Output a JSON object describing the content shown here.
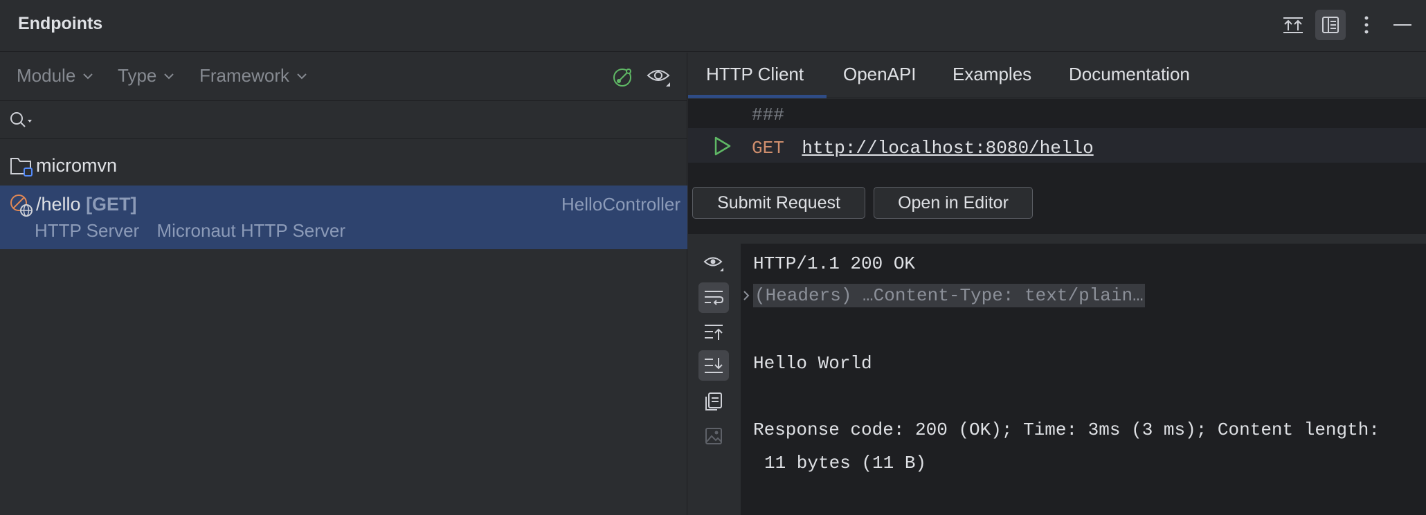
{
  "panel": {
    "title": "Endpoints"
  },
  "filters": {
    "module": "Module",
    "type": "Type",
    "framework": "Framework"
  },
  "tree": {
    "module_name": "micromvn",
    "endpoint": {
      "path": "/hello",
      "method": "[GET]",
      "controller": "HelloController",
      "server_type": "HTTP Server",
      "server_name": "Micronaut HTTP Server"
    }
  },
  "tabs": [
    "HTTP Client",
    "OpenAPI",
    "Examples",
    "Documentation"
  ],
  "editor": {
    "separator": "###",
    "method": "GET",
    "url": "http://localhost:8080/hello"
  },
  "buttons": {
    "submit": "Submit Request",
    "open_editor": "Open in Editor"
  },
  "response": {
    "status_line": "HTTP/1.1 200 OK",
    "headers_folded": "(Headers) …Content-Type: text/plain…",
    "body": "Hello World",
    "summary_line1": "Response code: 200 (OK); Time: 3ms (3 ms); Content length:",
    "summary_line2": "11 bytes (11 B)"
  },
  "colors": {
    "accent": "#3574f0",
    "selection": "#2e436e",
    "method_get": "#cf8e6d",
    "run_green": "#5fb865"
  }
}
